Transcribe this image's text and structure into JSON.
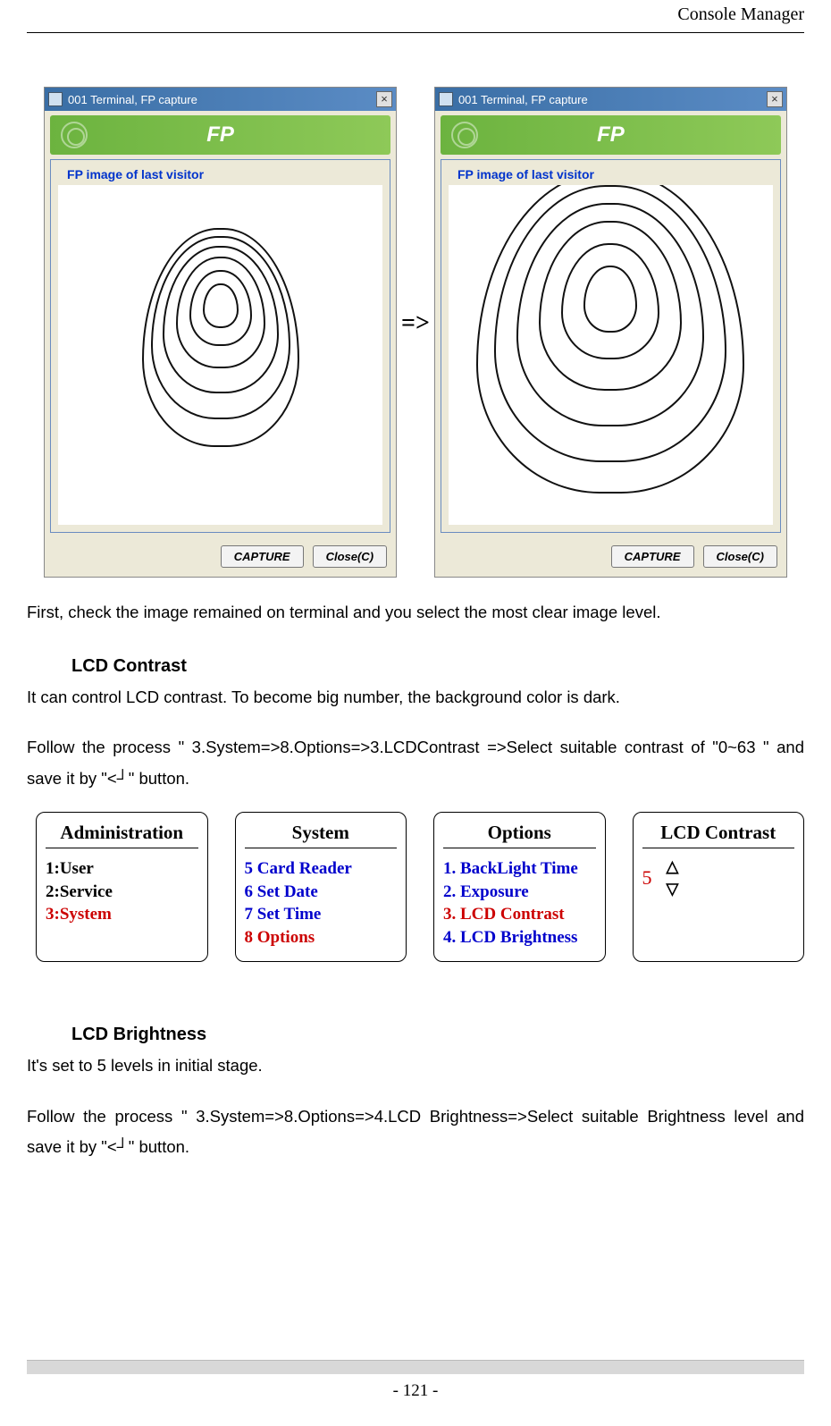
{
  "header": {
    "title": "Console Manager"
  },
  "windows": {
    "title": "001 Terminal, FP capture",
    "close": "×",
    "banner": "FP",
    "legend": "FP image of last visitor",
    "capture_btn": "CAPTURE",
    "close_btn": "Close(C)"
  },
  "arrow": "=>",
  "paragraphs": {
    "p1": "First, check the image remained on terminal and you select the most clear image level.",
    "lcd_contrast_title": "LCD Contrast",
    "p2": "It can control LCD contrast. To become big number, the background color is dark.",
    "p3": "Follow the process \" 3.System=>8.Options=>3.LCDContrast =>Select suitable contrast of \"0~63 \" and save it by \"<┘\"   button.",
    "lcd_brightness_title": "LCD Brightness",
    "p4": "It's set to 5 levels in initial stage.",
    "p5": "Follow the process \" 3.System=>8.Options=>4.LCD Brightness=>Select suitable Brightness level and save it by \"<┘\"   button."
  },
  "menus": {
    "admin": {
      "title": "Administration",
      "items": [
        "1:User",
        "2:Service",
        "3:System"
      ],
      "highlight_index": 2
    },
    "system": {
      "title": "System",
      "items": [
        "5 Card Reader",
        "6 Set Date",
        "7 Set Time",
        "8 Options"
      ],
      "highlight_index": 3
    },
    "options": {
      "title": "Options",
      "items": [
        "1. BackLight Time",
        "2. Exposure",
        "3. LCD Contrast",
        "4. LCD Brightness"
      ],
      "highlight_index": 2
    },
    "contrast": {
      "title": "LCD Contrast",
      "up": "△",
      "value": "5",
      "down": "▽"
    }
  },
  "footer": {
    "page": "- 121 -"
  }
}
